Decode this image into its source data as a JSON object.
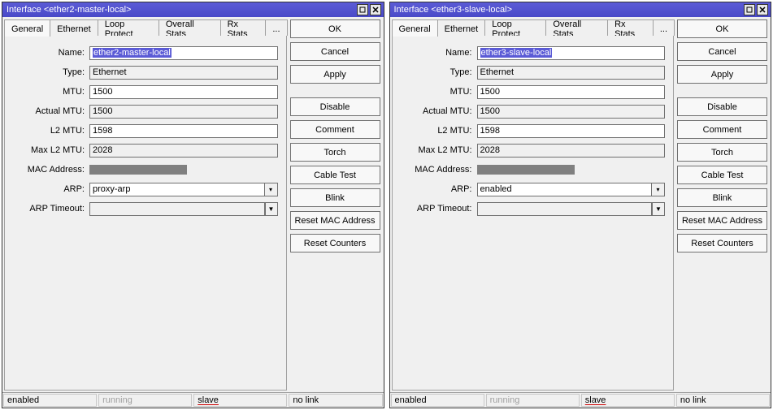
{
  "windows": [
    {
      "title": "Interface <ether2-master-local>",
      "tabs": [
        "General",
        "Ethernet",
        "Loop Protect",
        "Overall Stats",
        "Rx Stats",
        "..."
      ],
      "active_tab": 0,
      "fields": {
        "name_label": "Name:",
        "name_value": "ether2-master-local",
        "name_selected": true,
        "type_label": "Type:",
        "type_value": "Ethernet",
        "mtu_label": "MTU:",
        "mtu_value": "1500",
        "actual_mtu_label": "Actual MTU:",
        "actual_mtu_value": "1500",
        "l2mtu_label": "L2 MTU:",
        "l2mtu_value": "1598",
        "maxl2mtu_label": "Max L2 MTU:",
        "maxl2mtu_value": "2028",
        "mac_label": "MAC Address:",
        "arp_label": "ARP:",
        "arp_value": "proxy-arp",
        "arp_timeout_label": "ARP Timeout:",
        "arp_timeout_value": ""
      },
      "buttons": {
        "ok": "OK",
        "cancel": "Cancel",
        "apply": "Apply",
        "disable": "Disable",
        "comment": "Comment",
        "torch": "Torch",
        "cable_test": "Cable Test",
        "blink": "Blink",
        "reset_mac": "Reset MAC Address",
        "reset_counters": "Reset Counters"
      },
      "status": {
        "s1": "enabled",
        "s2": "running",
        "s3": "slave",
        "s4": "no link"
      }
    },
    {
      "title": "Interface <ether3-slave-local>",
      "tabs": [
        "General",
        "Ethernet",
        "Loop Protect",
        "Overall Stats",
        "Rx Stats",
        "..."
      ],
      "active_tab": 0,
      "fields": {
        "name_label": "Name:",
        "name_value": "ether3-slave-local",
        "name_selected": true,
        "type_label": "Type:",
        "type_value": "Ethernet",
        "mtu_label": "MTU:",
        "mtu_value": "1500",
        "actual_mtu_label": "Actual MTU:",
        "actual_mtu_value": "1500",
        "l2mtu_label": "L2 MTU:",
        "l2mtu_value": "1598",
        "maxl2mtu_label": "Max L2 MTU:",
        "maxl2mtu_value": "2028",
        "mac_label": "MAC Address:",
        "arp_label": "ARP:",
        "arp_value": "enabled",
        "arp_timeout_label": "ARP Timeout:",
        "arp_timeout_value": ""
      },
      "buttons": {
        "ok": "OK",
        "cancel": "Cancel",
        "apply": "Apply",
        "disable": "Disable",
        "comment": "Comment",
        "torch": "Torch",
        "cable_test": "Cable Test",
        "blink": "Blink",
        "reset_mac": "Reset MAC Address",
        "reset_counters": "Reset Counters"
      },
      "status": {
        "s1": "enabled",
        "s2": "running",
        "s3": "slave",
        "s4": "no link"
      }
    }
  ]
}
